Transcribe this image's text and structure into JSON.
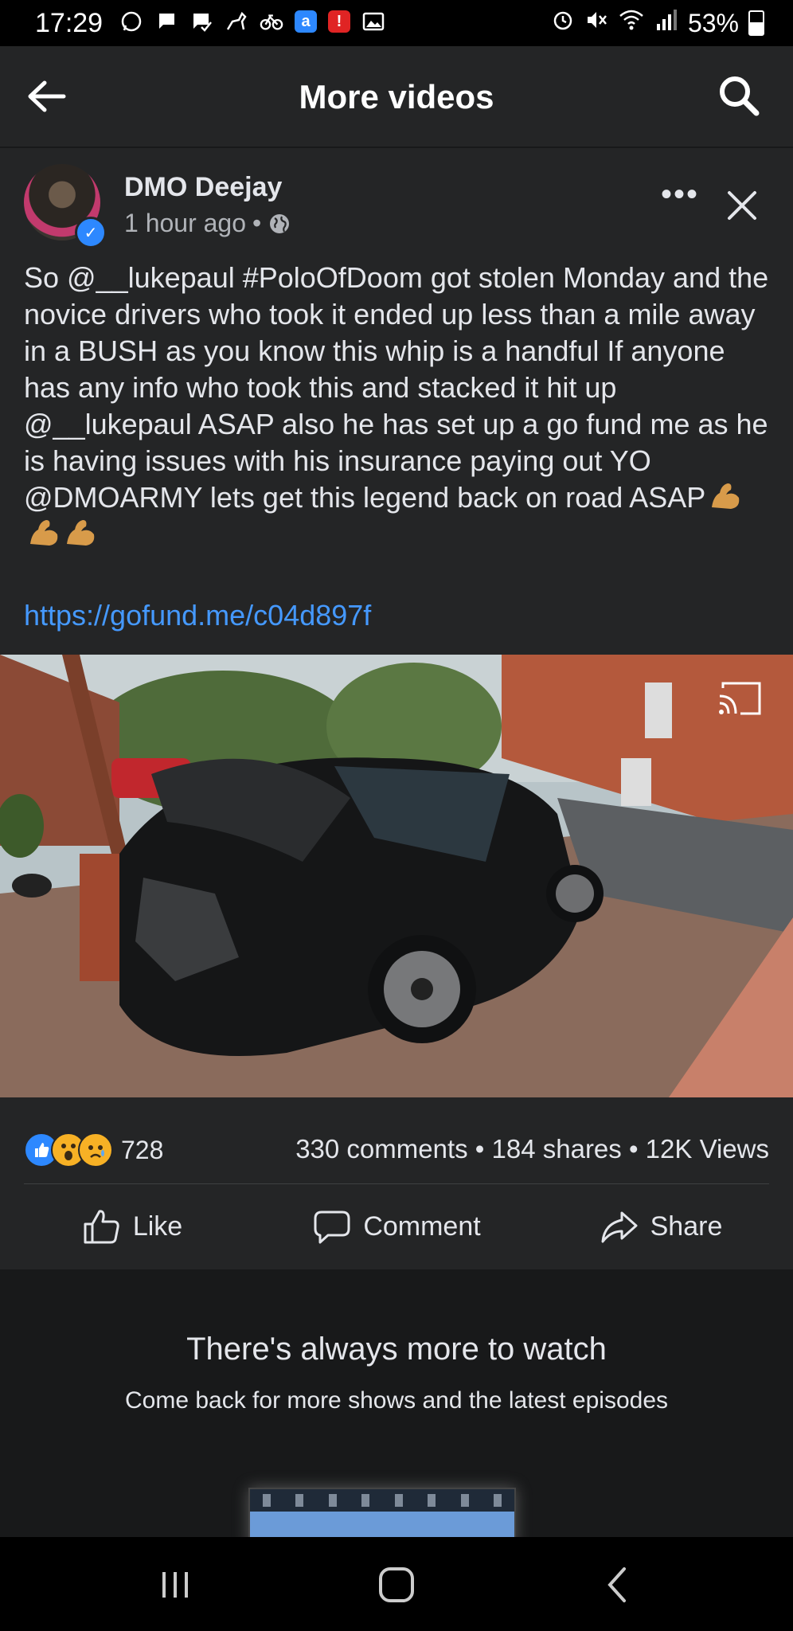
{
  "status_bar": {
    "time": "17:29",
    "battery": "53%",
    "notification_icons": [
      "whatsapp-icon",
      "chat-icon",
      "chat-check-icon",
      "horse-icon",
      "bike-icon",
      "a-app-icon",
      "alert-app-icon",
      "image-icon"
    ],
    "system_icons": [
      "alarm-icon",
      "mute-icon",
      "wifi-icon",
      "signal-icon",
      "battery-icon"
    ]
  },
  "app_bar": {
    "title": "More videos"
  },
  "post": {
    "author": "DMO Deejay",
    "timestamp": "1 hour ago",
    "separator": "•",
    "text": "So @__lukepaul #PoloOfDoom got stolen Monday and the novice drivers who took it ended up less than a mile away in a BUSH as you know this whip is a handful If anyone has any info who took this and stacked it hit up @__lukepaul ASAP also he has set up a go fund me as he is having issues with his insurance paying out YO @DMOARMY lets get this legend back on road ASAP",
    "emoji": [
      "flexed-biceps-icon",
      "flexed-biceps-icon",
      "flexed-biceps-icon"
    ],
    "link": "https://gofund.me/c04d897f"
  },
  "stats": {
    "reaction_count": "728",
    "reaction_icons": [
      "like-reaction-icon",
      "wow-reaction-icon",
      "sad-reaction-icon"
    ],
    "summary": "330 comments • 184 shares • 12K Views"
  },
  "actions": {
    "like": "Like",
    "comment": "Comment",
    "share": "Share"
  },
  "more_section": {
    "title": "There's always more to watch",
    "subtitle": "Come back for more shows and the latest episodes"
  },
  "colors": {
    "background": "#18191a",
    "card": "#242526",
    "link": "#4599ff",
    "verified": "#2d88ff"
  }
}
